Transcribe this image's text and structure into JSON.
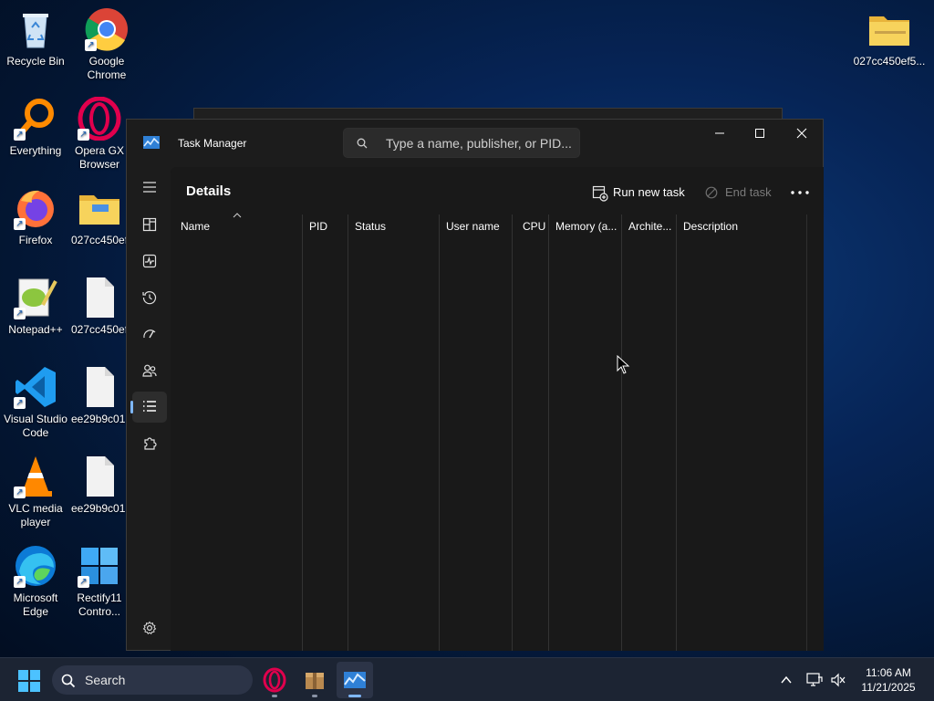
{
  "desktop": {
    "icons": [
      {
        "label": "Recycle Bin"
      },
      {
        "label": "Google Chrome"
      },
      {
        "label": "Everything"
      },
      {
        "label": "Opera GX Browser"
      },
      {
        "label": "Firefox"
      },
      {
        "label": "027cc450ef..."
      },
      {
        "label": "Notepad++"
      },
      {
        "label": "027cc450ef..."
      },
      {
        "label": "Visual Studio Code"
      },
      {
        "label": "ee29b9c01..."
      },
      {
        "label": "VLC media player"
      },
      {
        "label": "ee29b9c01..."
      },
      {
        "label": "Microsoft Edge"
      },
      {
        "label": "Rectify11 Contro..."
      },
      {
        "label": "027cc450ef5..."
      }
    ]
  },
  "task_manager": {
    "title": "Task Manager",
    "search_placeholder": "Type a name, publisher, or PID...",
    "page_title": "Details",
    "run_new_task": "Run new task",
    "end_task": "End task",
    "columns": [
      "Name",
      "PID",
      "Status",
      "User name",
      "CPU",
      "Memory (a...",
      "Archite...",
      "Description"
    ],
    "nav": [
      "hamburger-menu",
      "processes",
      "performance",
      "app-history",
      "startup-apps",
      "users",
      "details",
      "services"
    ],
    "active_nav": "details"
  },
  "taskbar": {
    "search_label": "Search",
    "time": "11:06 AM",
    "date": "11/21/2025"
  },
  "colors": {
    "accent": "#7fb8ff",
    "window_bg": "#1c1c1c",
    "taskbar_bg": "#1c2433"
  }
}
